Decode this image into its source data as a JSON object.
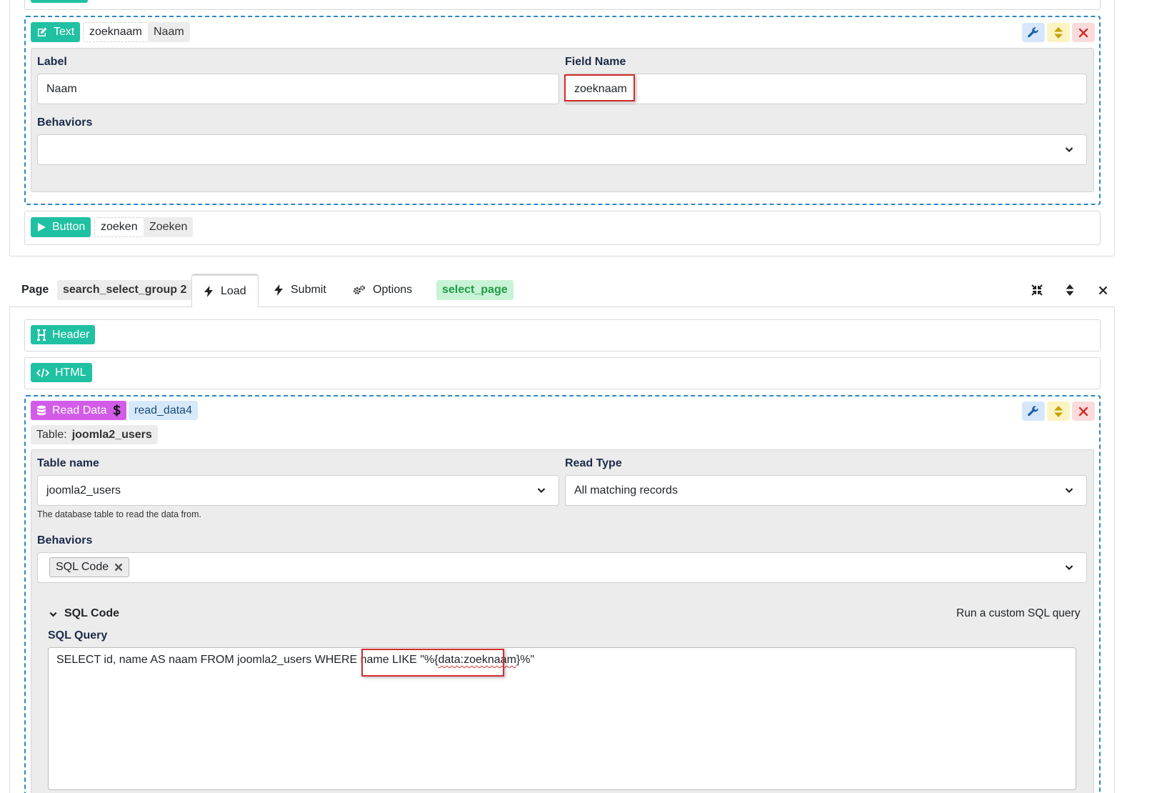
{
  "text_element": {
    "type_label": "Text",
    "field_name_badge": "zoeknaam",
    "label_badge": "Naam",
    "settings": {
      "label_title": "Label",
      "label_value": "Naam",
      "field_name_title": "Field Name",
      "field_name_value": "zoeknaam",
      "behaviors_title": "Behaviors",
      "behaviors_value": ""
    }
  },
  "button_element": {
    "type_label": "Button",
    "name_badge": "zoeken",
    "label_badge": "Zoeken"
  },
  "page_bar": {
    "page_label": "Page",
    "page_name": "search_select_group 2",
    "tabs": [
      {
        "label": "Load",
        "icon": "bolt-icon",
        "active": true
      },
      {
        "label": "Submit",
        "icon": "bolt-icon",
        "active": false
      },
      {
        "label": "Options",
        "icon": "gears-icon",
        "active": false
      }
    ],
    "page_alias": "select_page"
  },
  "header_element": {
    "type_label": "Header"
  },
  "html_element": {
    "type_label": "HTML"
  },
  "read_data_element": {
    "type_label": "Read Data",
    "name_badge": "read_data4",
    "table_prefix": "Table:",
    "table_value": "joomla2_users",
    "settings": {
      "table_name_title": "Table name",
      "table_name_value": "joomla2_users",
      "table_name_help": "The database table to read the data from.",
      "read_type_title": "Read Type",
      "read_type_value": "All matching records",
      "behaviors_title": "Behaviors",
      "behaviors_chips": [
        "SQL Code"
      ],
      "sql_section_title": "SQL Code",
      "sql_section_desc": "Run a custom SQL query",
      "sql_query_title": "SQL Query",
      "sql_query_part1": "SELECT id, name AS naam FROM joomla2_users WHERE name LIKE \"%{",
      "sql_query_part2": "data:zoeknaam",
      "sql_query_part3": "}%\""
    }
  },
  "colors": {
    "teal": "#20c1a2",
    "purple": "#d25ce8",
    "dashed_border": "#2f88c6",
    "highlight_red": "#d22d2d"
  }
}
